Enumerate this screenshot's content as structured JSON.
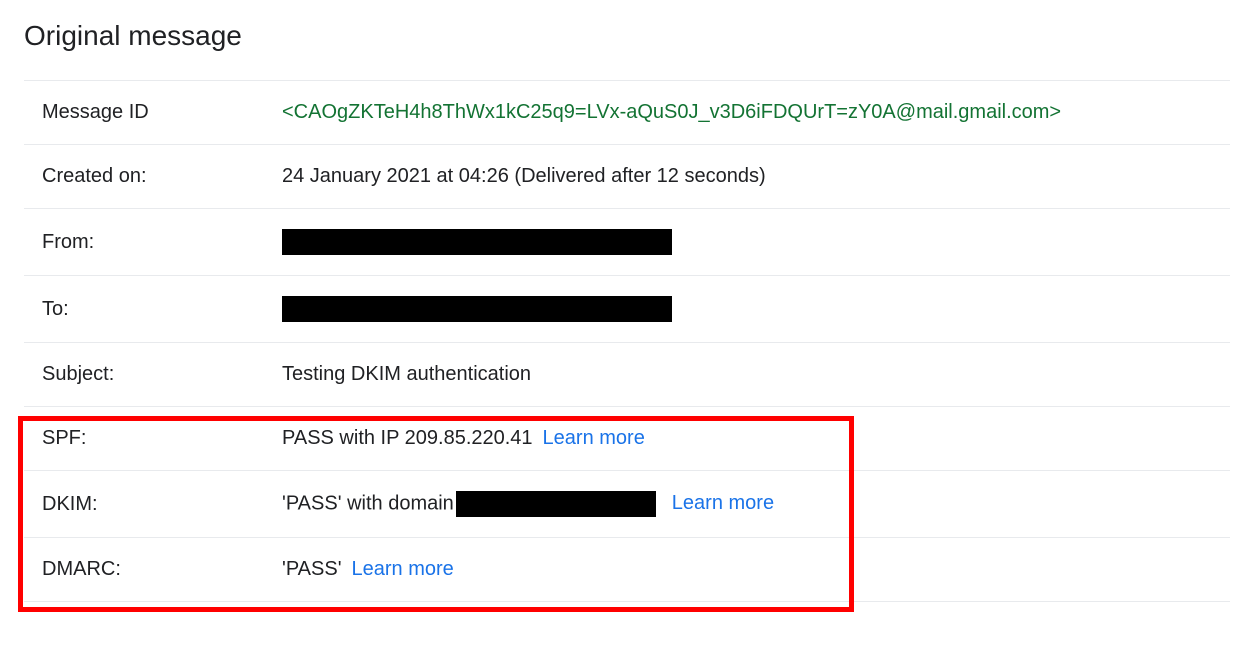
{
  "header": {
    "title": "Original message"
  },
  "rows": {
    "message_id": {
      "label": "Message ID",
      "value": "<CAOgZKTeH4h8ThWx1kC25q9=LVx-aQuS0J_v3D6iFDQUrT=zY0A@mail.gmail.com>"
    },
    "created_on": {
      "label": "Created on:",
      "value": "24 January 2021 at 04:26 (Delivered after 12 seconds)"
    },
    "from": {
      "label": "From:"
    },
    "to": {
      "label": "To:"
    },
    "subject": {
      "label": "Subject:",
      "value": "Testing DKIM authentication"
    },
    "spf": {
      "label": "SPF:",
      "value": "PASS with IP 209.85.220.41",
      "learn_more": "Learn more"
    },
    "dkim": {
      "label": "DKIM:",
      "prefix": "'PASS' with domain",
      "learn_more": "Learn more"
    },
    "dmarc": {
      "label": "DMARC:",
      "value": "'PASS'",
      "learn_more": "Learn more"
    }
  }
}
